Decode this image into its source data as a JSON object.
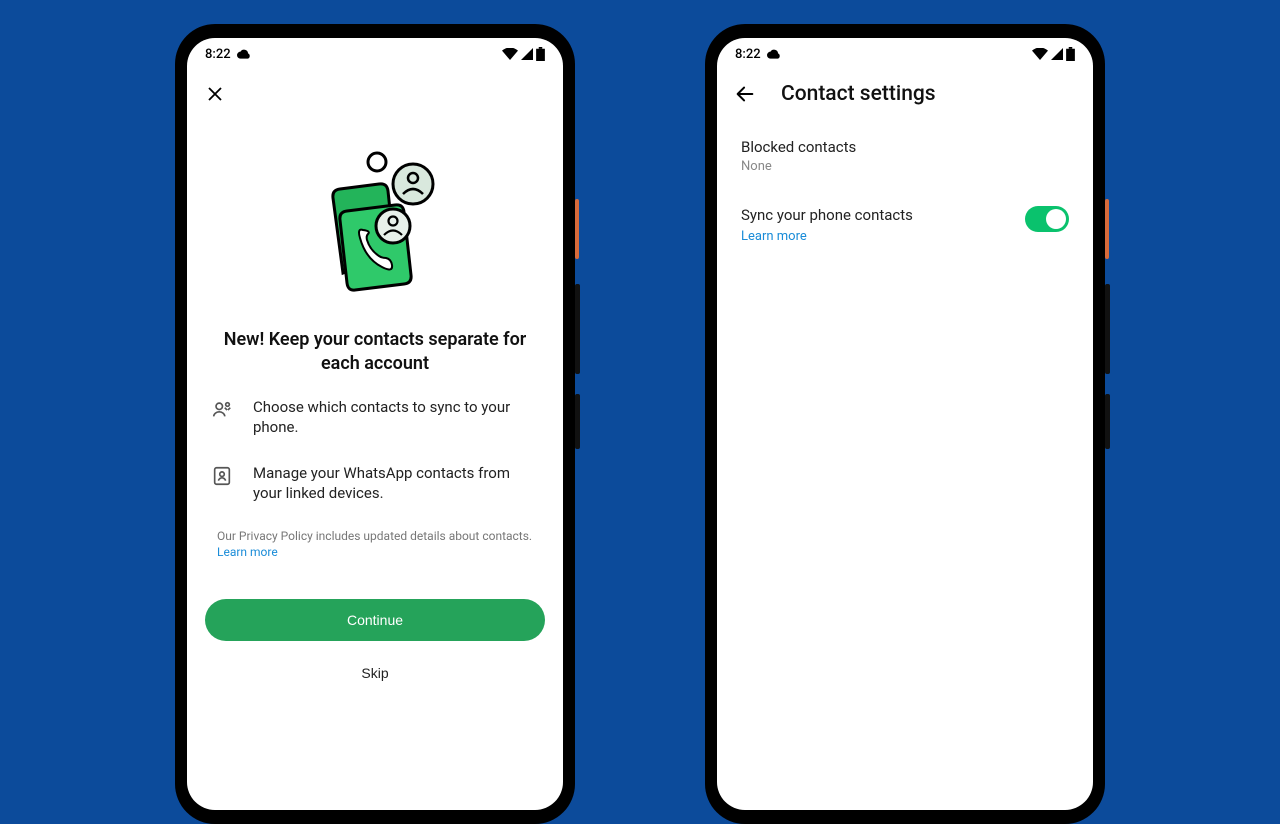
{
  "statusbar": {
    "time": "8:22"
  },
  "screen1": {
    "headline": "New! Keep your contacts separate for each account",
    "bullets": [
      "Choose which contacts to sync to your phone.",
      "Manage your WhatsApp contacts from your linked devices."
    ],
    "privacy_text": "Our Privacy Policy includes updated details about contacts. ",
    "privacy_link": "Learn more",
    "continue": "Continue",
    "skip": "Skip"
  },
  "screen2": {
    "title": "Contact settings",
    "blocked_label": "Blocked contacts",
    "blocked_value": "None",
    "sync_label": "Sync your phone contacts",
    "sync_link": "Learn more",
    "sync_on": true
  }
}
